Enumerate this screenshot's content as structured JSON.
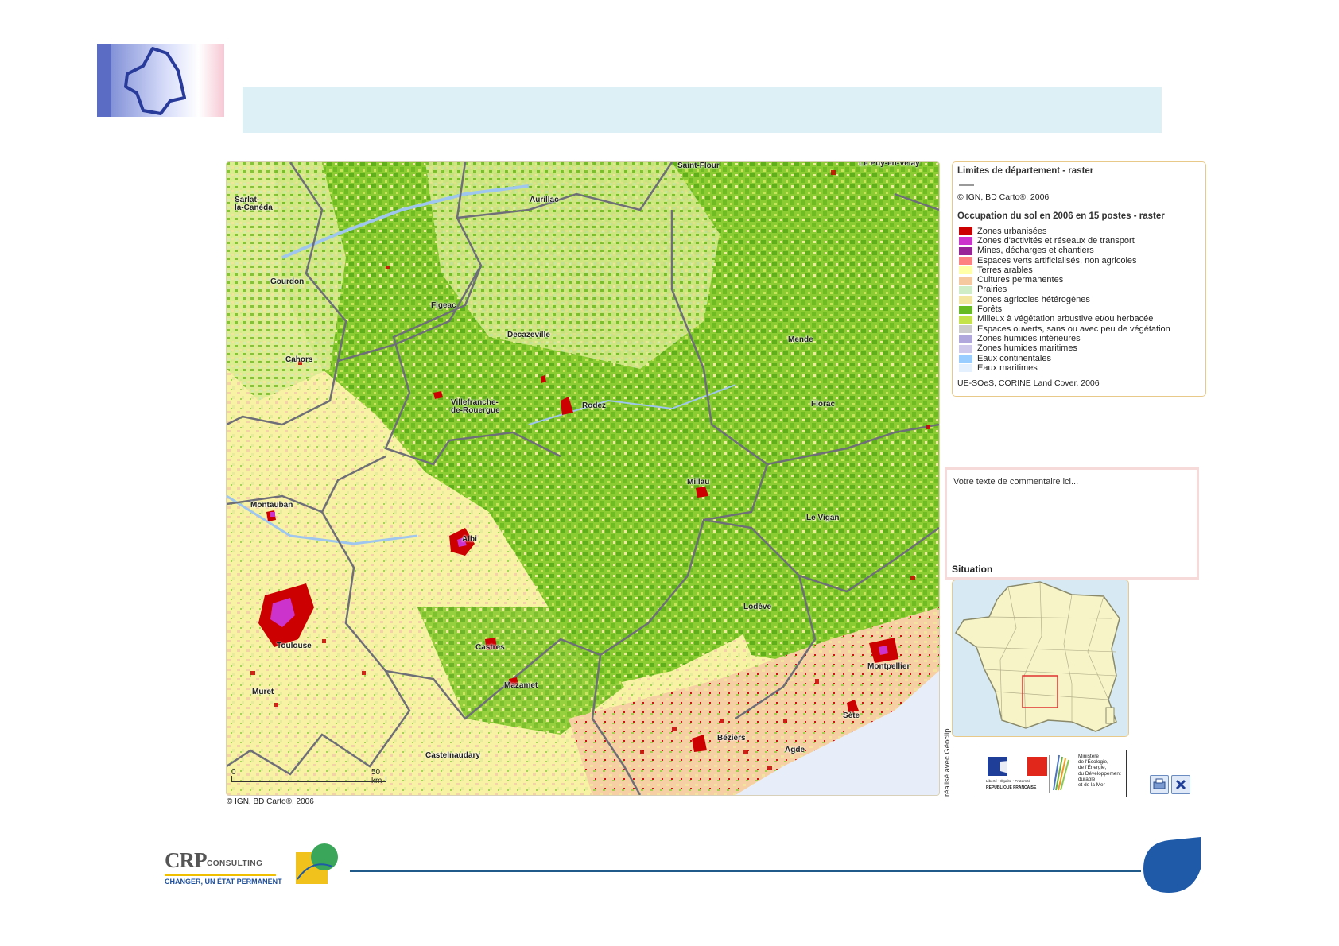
{
  "header": {
    "logo": {
      "icon": "region-outline-logo"
    }
  },
  "map": {
    "copyright": "© IGN, BD Carto®, 2006",
    "scale": {
      "zero": "0",
      "max": "50 km"
    },
    "cities": [
      "Saint-Flour",
      "Le Puy-en-Velay",
      "Sarlat-\nla-Canéda",
      "Aurillac",
      "Gourdon",
      "Figeac",
      "Decazeville",
      "Mende",
      "Cahors",
      "Villefranche-\nde-Rouergue",
      "Rodez",
      "Florac",
      "Millau",
      "Montauban",
      "Le Vigan",
      "Albi",
      "Lodève",
      "Toulouse",
      "Castres",
      "Montpellier",
      "Muret",
      "Mazamet",
      "Sète",
      "Béziers",
      "Agde",
      "Castelnaudary"
    ]
  },
  "legend": {
    "dept_title": "Limites de département - raster",
    "dept_source": "© IGN, BD Carto®, 2006",
    "landuse_title": "Occupation du sol en 2006 en 15 postes - raster",
    "items": [
      {
        "label": "Zones urbanisées",
        "color": "#cc0000"
      },
      {
        "label": "Zones d'activités et réseaux de transport",
        "color": "#cc33cc"
      },
      {
        "label": "Mines, décharges et chantiers",
        "color": "#992299"
      },
      {
        "label": "Espaces verts artificialisés, non agricoles",
        "color": "#ff8080"
      },
      {
        "label": "Terres arables",
        "color": "#ffffa8"
      },
      {
        "label": "Cultures permanentes",
        "color": "#f5c8a0"
      },
      {
        "label": "Prairies",
        "color": "#cfeec8"
      },
      {
        "label": "Zones agricoles hétérogènes",
        "color": "#f2e6a0"
      },
      {
        "label": "Forêts",
        "color": "#66bb22"
      },
      {
        "label": "Milieux à végétation arbustive et/ou herbacée",
        "color": "#c4e24a"
      },
      {
        "label": "Espaces ouverts, sans ou avec peu de végétation",
        "color": "#cccccc"
      },
      {
        "label": "Zones humides intérieures",
        "color": "#b0a8dd"
      },
      {
        "label": "Zones humides maritimes",
        "color": "#cfc9ec"
      },
      {
        "label": "Eaux continentales",
        "color": "#99ccff"
      },
      {
        "label": "Eaux maritimes",
        "color": "#e5f0ff"
      }
    ],
    "landuse_source": "UE-SOeS, CORINE Land Cover, 2006"
  },
  "comment": {
    "placeholder": "Votre texte de commentaire ici..."
  },
  "situation": {
    "label": "Situation"
  },
  "credit": "réalisé avec Géoclip",
  "ministry": {
    "rf_caption": "Liberté • Égalité • Fraternité",
    "rf_name": "RÉPUBLIQUE FRANÇAISE",
    "text": "Ministère\nde l'Écologie,\nde l'Énergie,\ndu Développement\ndurable\net de la Mer"
  },
  "footer": {
    "crp": "CRP",
    "crp_consulting": "CONSULTING",
    "crp_tagline": "CHANGER, UN ÉTAT PERMANENT"
  },
  "colors": {
    "header_band": "#ddf0f5",
    "footer_line": "#1f5a8a",
    "brand_blue": "#1e5aa8",
    "legend_border": "#e8c98a"
  }
}
